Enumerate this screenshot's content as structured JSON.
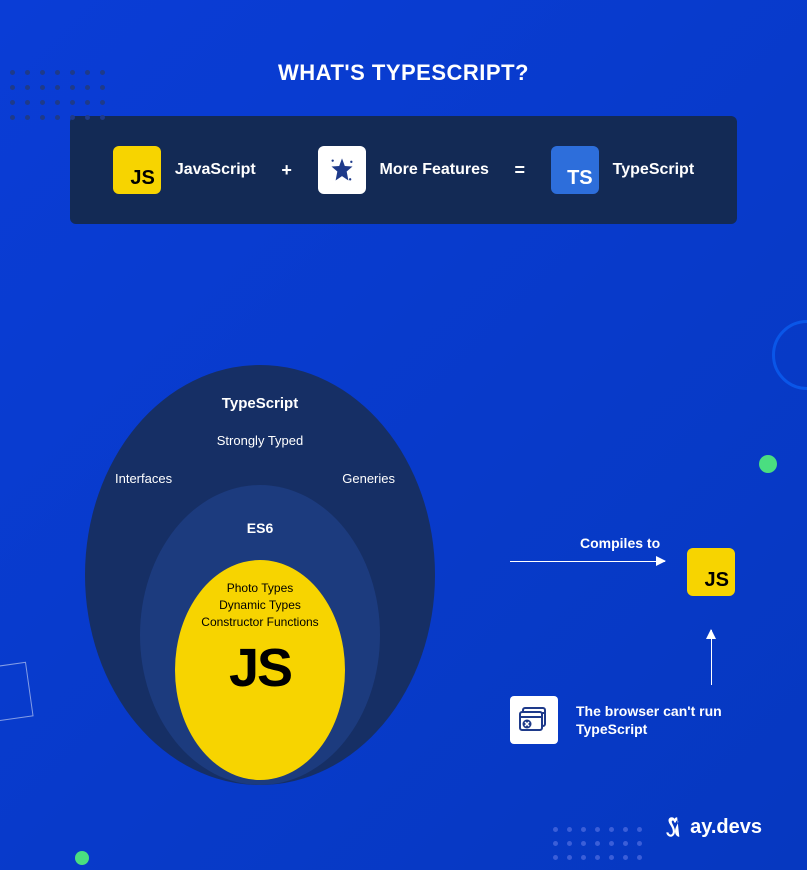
{
  "title": "WHAT'S TYPESCRIPT?",
  "equation": {
    "js_label": "JavaScript",
    "plus": "+",
    "features_label": "More Features",
    "equals": "=",
    "ts_label": "TypeScript",
    "js_icon_text": "JS",
    "ts_icon_text": "TS"
  },
  "venn": {
    "outer": {
      "title": "TypeScript",
      "strongly": "Strongly Typed",
      "interfaces": "Interfaces",
      "generics": "Generies"
    },
    "mid": {
      "title": "ES6"
    },
    "inner": {
      "line1": "Photo Types",
      "line2": "Dynamic Types",
      "line3": "Constructor Functions",
      "big": "JS"
    }
  },
  "compiles": {
    "label": "Compiles to",
    "target_icon_text": "JS"
  },
  "browser": {
    "text": "The browser can't run TypeScript"
  },
  "logo": {
    "text": "ay.devs"
  }
}
